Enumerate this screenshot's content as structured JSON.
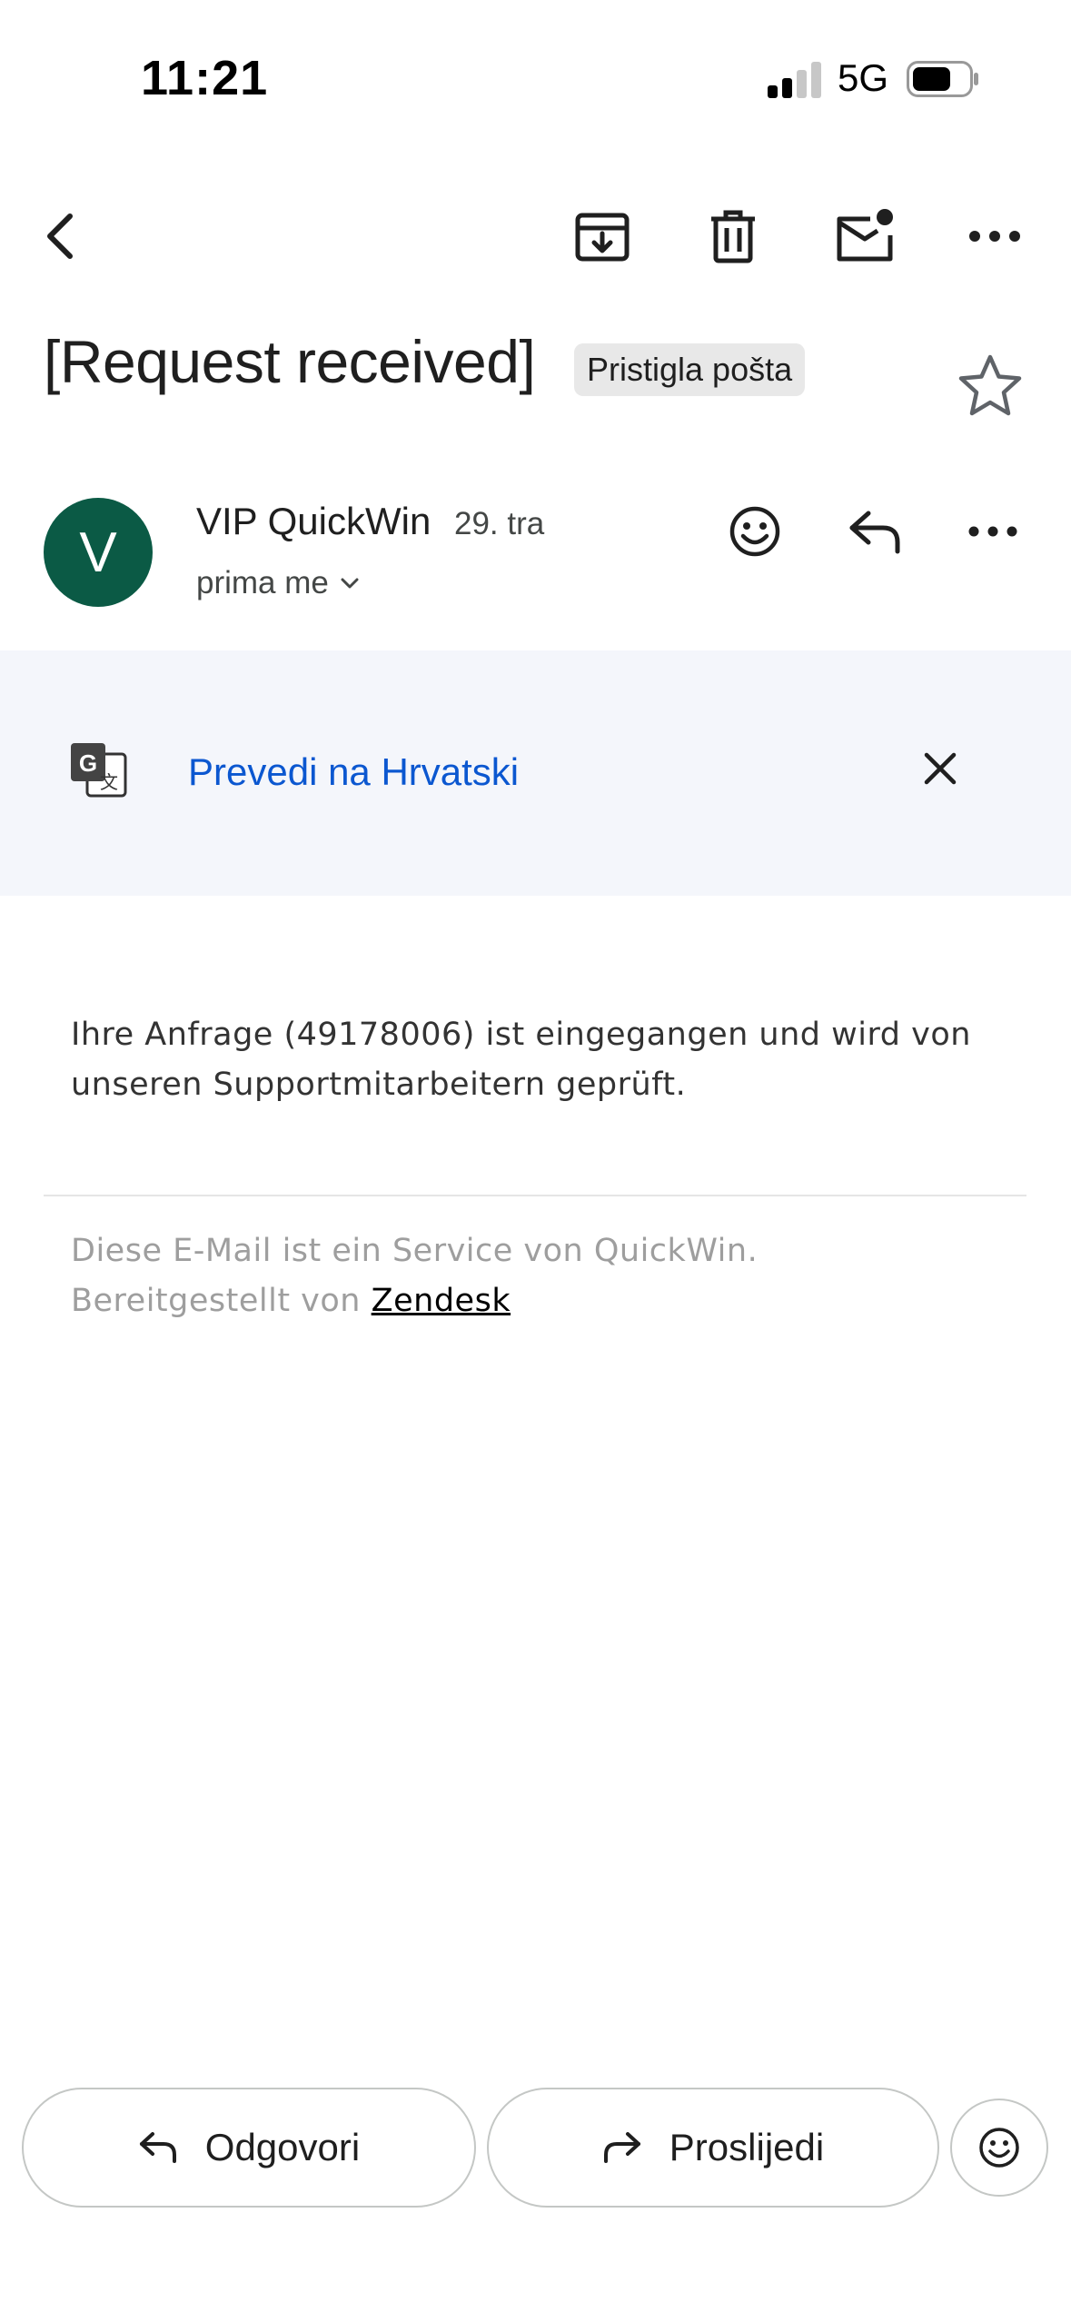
{
  "status_bar": {
    "time": "11:21",
    "network": "5G",
    "battery_level": 0.7
  },
  "toolbar": {
    "back_icon": "chevron-left-icon",
    "archive_icon": "archive-icon",
    "delete_icon": "trash-icon",
    "mark_unread_icon": "mark-unread-icon",
    "more_icon": "more-horiz-icon"
  },
  "email": {
    "subject": "[Request received]",
    "label": "Pristigla pošta",
    "starred": false,
    "sender": {
      "avatar_letter": "V",
      "avatar_color": "#0b5a45",
      "name": "VIP QuickWin",
      "date": "29. tra",
      "recipient": "prima me"
    },
    "translate": {
      "text": "Prevedi na Hrvatski",
      "link_color": "#0b57d0"
    },
    "body": "Ihre Anfrage (49178006) ist eingegangen und wird von unseren Supportmitarbeitern geprüft.",
    "footer": {
      "line1": "Diese E-Mail ist ein Service von QuickWin.",
      "line2_prefix": "Bereitgestellt von",
      "link": "Zendesk"
    }
  },
  "actions": {
    "reply": "Odgovori",
    "forward": "Proslijedi"
  }
}
